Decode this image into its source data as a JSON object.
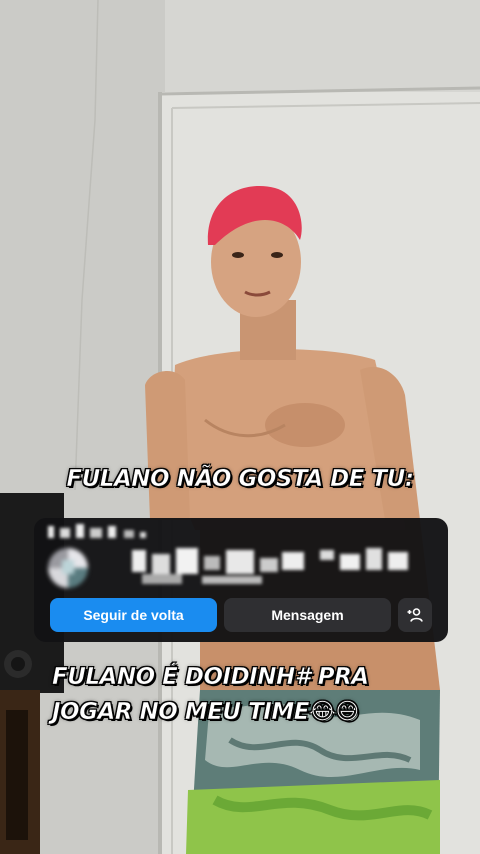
{
  "captions": {
    "top": "FULANO NÃO GOSTA DE TU:",
    "bottom_line1": "FULANO É DOIDINH# PRA",
    "bottom_line2": "JOGAR NO MEU TIME😂😅"
  },
  "profile_card": {
    "follow_back_label": "Seguir de volta",
    "message_label": "Mensagem",
    "add_person_icon": "add-person-icon"
  },
  "colors": {
    "follow_button": "#1a8cf0",
    "secondary_button": "#2f2f32",
    "card_background": "#121214"
  }
}
